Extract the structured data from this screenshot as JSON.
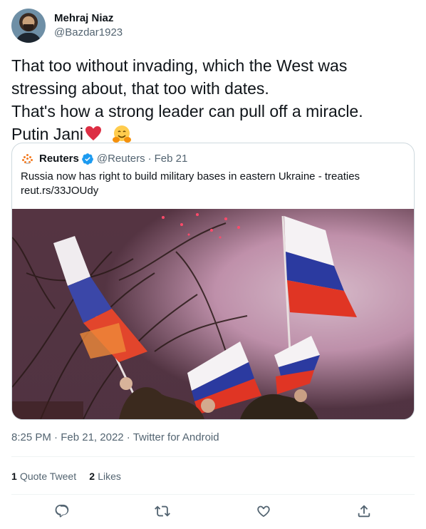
{
  "author": {
    "display_name": "Mehraj Niaz",
    "handle": "@Bazdar1923"
  },
  "tweet": {
    "lines": [
      "That too without invading, which the West was",
      "stressing about, that too with dates.",
      "That's how a strong leader can pull off a miracle.",
      "Putin Jani"
    ],
    "emojis": [
      "heart-icon",
      "hugging-face-icon"
    ]
  },
  "quoted": {
    "name": "Reuters",
    "handle": "@Reuters",
    "date": "Feb 21",
    "separator": "·",
    "text": "Russia now has right to build military bases in eastern Ukraine - treaties",
    "link": "reut.rs/33JOUdy",
    "image_alt": "People waving Russian flags at night with smoke and fireworks"
  },
  "meta": {
    "time": "8:25 PM",
    "date": "Feb 21, 2022",
    "source": "Twitter for Android",
    "separator": "·"
  },
  "stats": {
    "quote_count": "1",
    "quote_label": "Quote Tweet",
    "like_count": "2",
    "like_label": "Likes"
  },
  "colors": {
    "text": "#0f1419",
    "secondary": "#536471",
    "border": "#cfd9de",
    "verified": "#1d9bf0",
    "heart": "#e0245e"
  }
}
